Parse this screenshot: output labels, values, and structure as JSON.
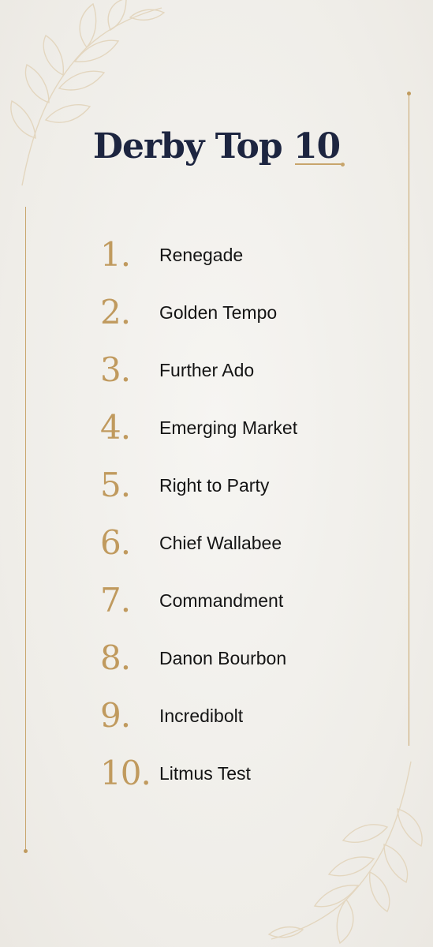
{
  "title": {
    "prefix": "Derby Top",
    "number": "10"
  },
  "rankings": [
    {
      "rank": "1.",
      "name": "Renegade"
    },
    {
      "rank": "2.",
      "name": "Golden Tempo"
    },
    {
      "rank": "3.",
      "name": "Further Ado"
    },
    {
      "rank": "4.",
      "name": "Emerging Market"
    },
    {
      "rank": "5.",
      "name": "Right to Party"
    },
    {
      "rank": "6.",
      "name": "Chief Wallabee"
    },
    {
      "rank": "7.",
      "name": "Commandment"
    },
    {
      "rank": "8.",
      "name": "Danon Bourbon"
    },
    {
      "rank": "9.",
      "name": "Incredibolt"
    },
    {
      "rank": "10.",
      "name": "Litmus Test"
    }
  ],
  "colors": {
    "title": "#1d2540",
    "accent_gold": "#c09a5e",
    "text": "#141414",
    "background": "#f2f0ec"
  },
  "icons": {
    "top_left": "leaf-branch-icon",
    "bottom_right": "leaf-branch-icon"
  }
}
